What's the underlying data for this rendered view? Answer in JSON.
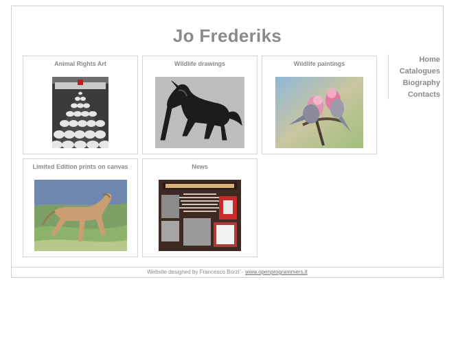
{
  "site": {
    "title": "Jo Frederiks"
  },
  "nav": {
    "items": [
      {
        "label": "Home"
      },
      {
        "label": "Catalogues"
      },
      {
        "label": "Biography"
      },
      {
        "label": "Contacts"
      }
    ]
  },
  "gallery": {
    "cards": [
      {
        "title": "Animal Rights Art",
        "image": "protest-art-thumbnail"
      },
      {
        "title": "Wildlife drawings",
        "image": "horse-drawing-thumbnail"
      },
      {
        "title": "Wildlife paintings",
        "image": "parrots-painting-thumbnail"
      },
      {
        "title": "Limited Edition prints on canvas",
        "image": "horse-painting-thumbnail"
      },
      {
        "title": "News",
        "image": "news-poster-thumbnail"
      }
    ]
  },
  "footer": {
    "credit": "Website designed by Francesco Borzi' - ",
    "link": "www.openprogrammers.it"
  },
  "colors": {
    "text_gray": "#8a8a8a",
    "border_gray": "#d6d6d6"
  }
}
